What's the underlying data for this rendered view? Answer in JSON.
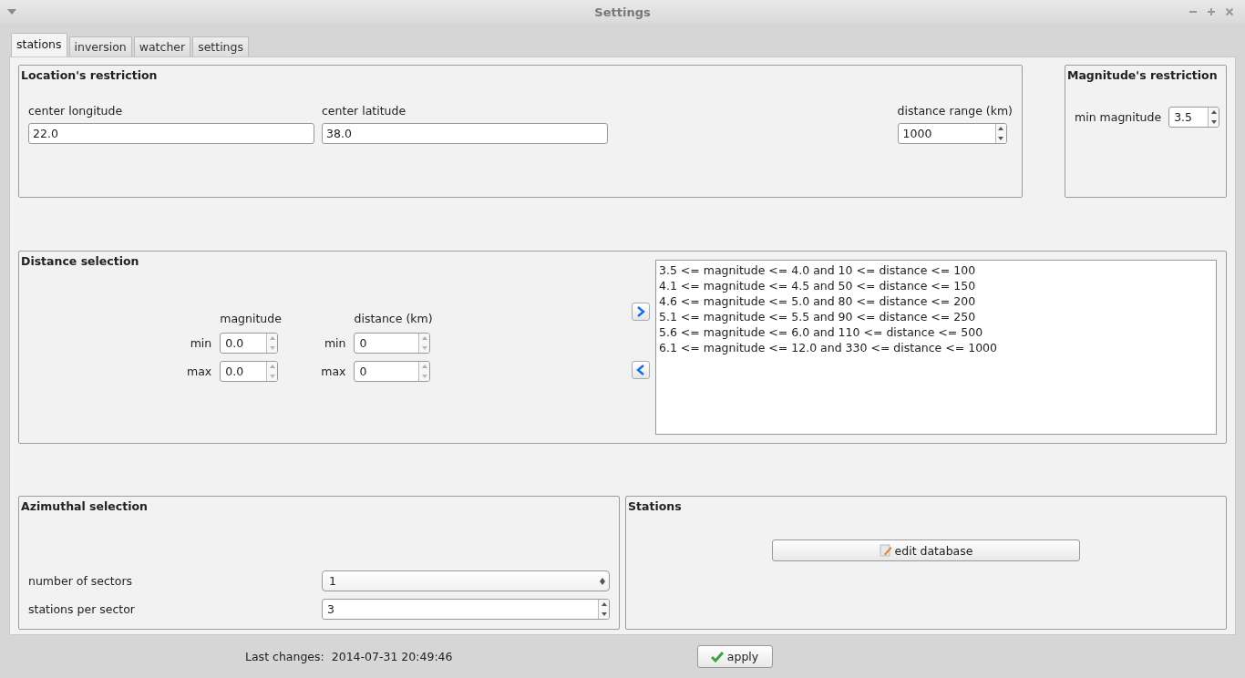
{
  "window": {
    "title": "Settings"
  },
  "tabs": [
    {
      "label": "stations",
      "selected": true
    },
    {
      "label": "inversion",
      "selected": false
    },
    {
      "label": "watcher",
      "selected": false
    },
    {
      "label": "settings",
      "selected": false
    }
  ],
  "location_restriction": {
    "title": "Location's restriction",
    "fields": [
      {
        "label": "center longitude",
        "value": "22.0"
      },
      {
        "label": "center latitude",
        "value": "38.0"
      }
    ],
    "distance_range": {
      "label": "distance range (km)",
      "value": "1000"
    }
  },
  "magnitude_restriction": {
    "title": "Magnitude's restriction",
    "label": "min magnitude",
    "value": "3.5"
  },
  "distance_selection": {
    "title": "Distance selection",
    "magnitude_header": "magnitude",
    "distance_header": "distance (km)",
    "rows": [
      {
        "magnitude_label": "min",
        "magnitude": "0.0",
        "distance_label": "min",
        "distance": "0"
      },
      {
        "magnitude_label": "max",
        "magnitude": "0.0",
        "distance_label": "max",
        "distance": "0"
      }
    ],
    "list": [
      "3.5 <= magnitude <= 4.0 and 10 <= distance <= 100",
      "4.1 <= magnitude <= 4.5 and 50 <= distance <= 150",
      "4.6 <= magnitude <= 5.0 and 80 <= distance <= 200",
      "5.1 <= magnitude <= 5.5 and 90 <= distance <= 250",
      "5.6 <= magnitude <= 6.0 and 110 <= distance <= 500",
      "6.1 <= magnitude <= 12.0 and 330 <= distance <= 1000"
    ]
  },
  "azimuthal_selection": {
    "title": "Azimuthal selection",
    "rows": [
      {
        "label": "number of sectors",
        "value": "1",
        "kind": "combo"
      },
      {
        "label": "stations per sector",
        "value": "3",
        "kind": "spin"
      }
    ]
  },
  "stations": {
    "title": "Stations",
    "button": "edit database"
  },
  "status": {
    "label": "Last changes:",
    "value": "2014-07-31 20:49:46"
  },
  "apply_button": "apply"
}
